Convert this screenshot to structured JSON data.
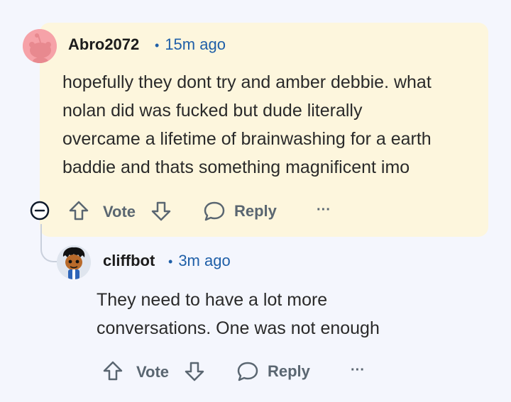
{
  "comments": [
    {
      "username": "Abro2072",
      "time": "15m ago",
      "body_lines": [
        "hopefully they dont try and amber debbie. what",
        "nolan did was fucked but dude literally",
        "overcame a lifetime of brainwashing for a earth",
        "baddie and thats something magnificent imo"
      ],
      "vote_label": "Vote",
      "reply_label": "Reply",
      "more_label": "···",
      "highlighted": true
    },
    {
      "username": "cliffbot",
      "time": "3m ago",
      "body_lines": [
        "They need to have a lot more",
        "conversations. One was not enough"
      ],
      "vote_label": "Vote",
      "reply_label": "Reply",
      "more_label": "···"
    }
  ],
  "separator": "•",
  "colors": {
    "highlight_bg": "#fdf6dd",
    "page_bg": "#f4f6fd",
    "time_link": "#1f5fa8",
    "action_gray": "#5a6671"
  },
  "icons": [
    "collapse-icon",
    "upvote-icon",
    "downvote-icon",
    "reply-bubble-icon",
    "more-options-icon",
    "snoo-avatar-icon"
  ]
}
